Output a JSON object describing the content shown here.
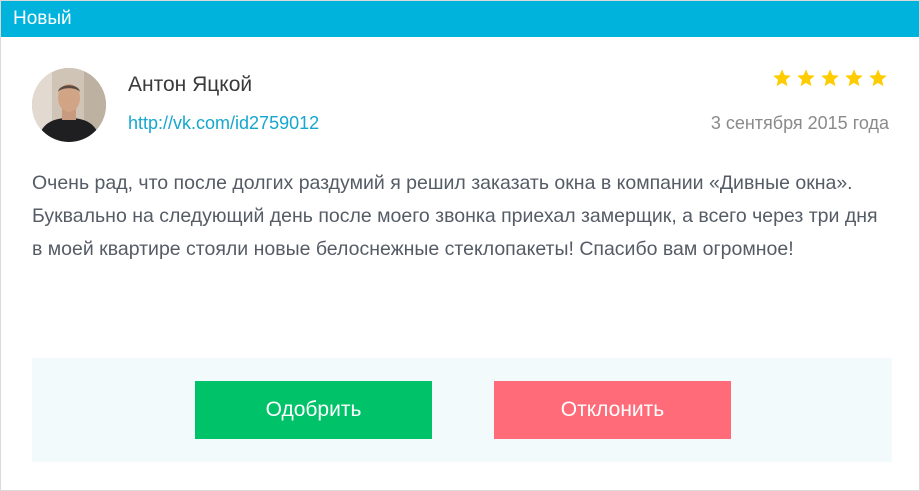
{
  "status": {
    "label": "Новый",
    "color": "#00b3dd"
  },
  "review": {
    "author": "Антон Яцкой",
    "profile_link": "http://vk.com/id2759012",
    "date": "3 сентября 2015 года",
    "rating": 5,
    "rating_max": 5,
    "star_color": "#ffcc00",
    "text": "Очень рад, что после долгих раздумий я решил заказать окна в компании «Дивные окна». Буквально на следующий день после моего звонка приехал замерщик, а всего через три дня в моей квартире стояли новые белоснежные стеклопакеты! Спасибо вам огромное!"
  },
  "actions": {
    "approve_label": "Одобрить",
    "approve_color": "#00c269",
    "reject_label": "Отклонить",
    "reject_color": "#ff6b78"
  }
}
